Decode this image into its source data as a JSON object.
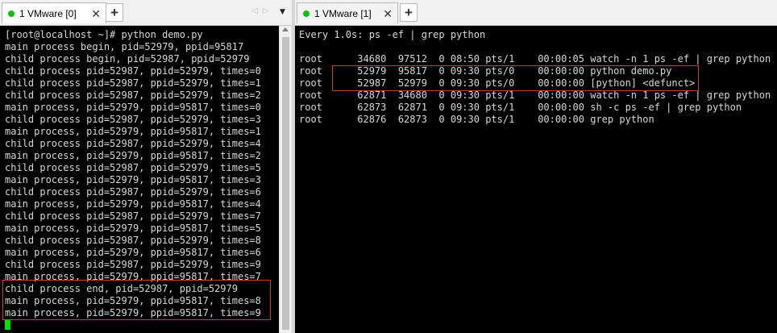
{
  "left_tab": {
    "label": "1 VMware [0]"
  },
  "right_tab": {
    "label": "1 VMware [1]"
  },
  "left_terminal": {
    "lines": [
      "[root@localhost ~]# python demo.py",
      "main process begin, pid=52979, ppid=95817",
      "child process begin, pid=52987, ppid=52979",
      "child process pid=52987, ppid=52979, times=0",
      "child process pid=52987, ppid=52979, times=1",
      "child process pid=52987, ppid=52979, times=2",
      "main process, pid=52979, ppid=95817, times=0",
      "child process pid=52987, ppid=52979, times=3",
      "main process, pid=52979, ppid=95817, times=1",
      "child process pid=52987, ppid=52979, times=4",
      "main process, pid=52979, ppid=95817, times=2",
      "child process pid=52987, ppid=52979, times=5",
      "main process, pid=52979, ppid=95817, times=3",
      "child process pid=52987, ppid=52979, times=6",
      "main process, pid=52979, ppid=95817, times=4",
      "child process pid=52987, ppid=52979, times=7",
      "main process, pid=52979, ppid=95817, times=5",
      "child process pid=52987, ppid=52979, times=8",
      "main process, pid=52979, ppid=95817, times=6",
      "child process pid=52987, ppid=52979, times=9",
      "main process, pid=52979, ppid=95817, times=7",
      "child process end, pid=52987, ppid=52979",
      "main process, pid=52979, ppid=95817, times=8",
      "main process, pid=52979, ppid=95817, times=9"
    ]
  },
  "right_terminal": {
    "header": "Every 1.0s: ps -ef | grep python",
    "rows": [
      "root      34680  97512  0 08:50 pts/1    00:00:05 watch -n 1 ps -ef | grep python",
      "root      52979  95817  0 09:30 pts/0    00:00:00 python demo.py",
      "root      52987  52979  0 09:30 pts/0    00:00:00 [python] <defunct>",
      "root      62871  34680  0 09:30 pts/1    00:00:00 watch -n 1 ps -ef | grep python",
      "root      62873  62871  0 09:30 pts/1    00:00:00 sh -c ps -ef | grep python",
      "root      62876  62873  0 09:30 pts/1    00:00:00 grep python"
    ]
  },
  "colors": {
    "terminal_bg": "#000000",
    "terminal_fg": "#d8d8d8",
    "cursor": "#00e000",
    "highlight_box": "#d23a3a",
    "tab_status_dot": "#10c010"
  }
}
